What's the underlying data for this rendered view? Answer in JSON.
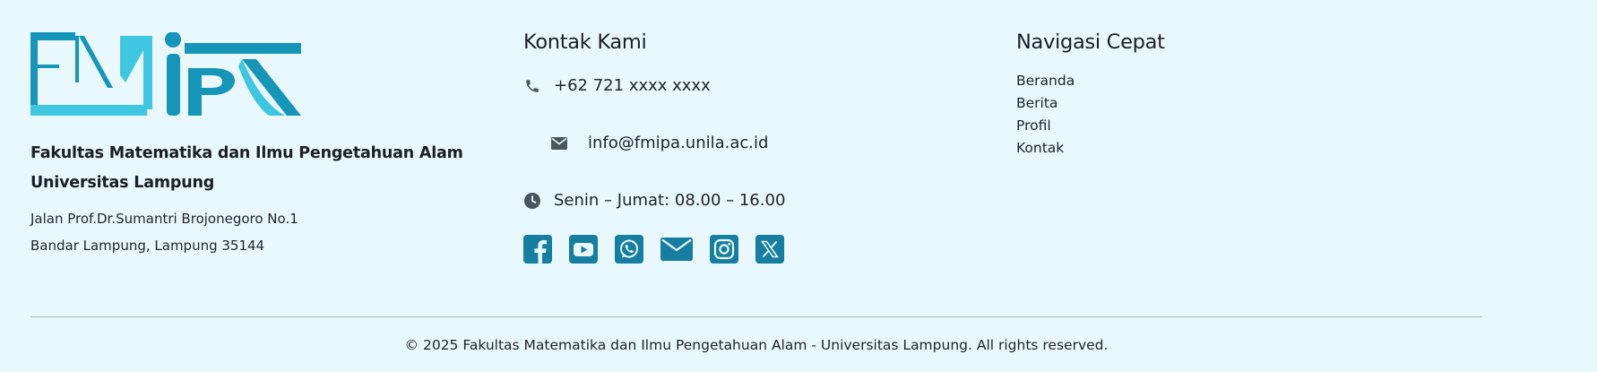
{
  "brand": {
    "logo_text": "FMIPA",
    "name_line1": "Fakultas Matematika dan Ilmu Pengetahuan Alam",
    "name_line2": "Universitas Lampung",
    "address_line1": "Jalan Prof.Dr.Sumantri Brojonegoro No.1",
    "address_line2": "Bandar Lampung, Lampung 35144"
  },
  "contact": {
    "title": "Kontak Kami",
    "phone": "+62 721 xxxx xxxx",
    "email": "info@fmipa.unila.ac.id",
    "hours": "Senin – Jumat: 08.00 – 16.00",
    "socials": [
      {
        "icon": "facebook-icon"
      },
      {
        "icon": "youtube-icon"
      },
      {
        "icon": "whatsapp-icon"
      },
      {
        "icon": "mail-icon"
      },
      {
        "icon": "instagram-icon"
      },
      {
        "icon": "x-twitter-icon"
      }
    ]
  },
  "quicknav": {
    "title": "Navigasi Cepat",
    "items": [
      {
        "label": "Beranda"
      },
      {
        "label": "Berita"
      },
      {
        "label": "Profil"
      },
      {
        "label": "Kontak"
      }
    ]
  },
  "footer": {
    "copyright": "© 2025 Fakultas Matematika dan Ilmu Pengetahuan Alam - Universitas Lampung. All rights reserved."
  },
  "colors": {
    "background": "#e8f8fd",
    "logo_dark": "#1596b9",
    "logo_light": "#3fc6e0",
    "social_icon": "#167ea0",
    "divider": "#aab8c0"
  }
}
